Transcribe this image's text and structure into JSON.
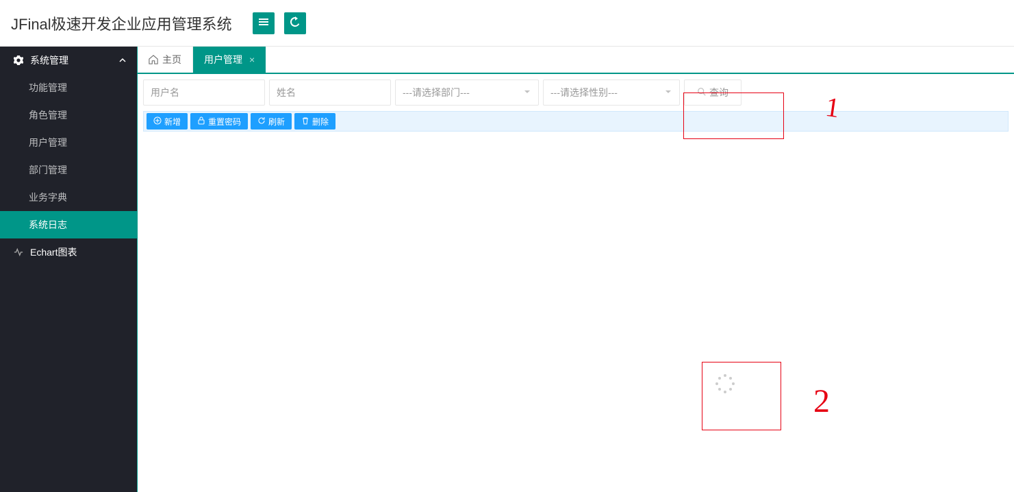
{
  "header": {
    "title": "JFinal极速开发企业应用管理系统"
  },
  "sidebar": {
    "sections": [
      {
        "label": "系统管理",
        "expanded": true
      },
      {
        "label": "功能管理"
      },
      {
        "label": "角色管理"
      },
      {
        "label": "用户管理"
      },
      {
        "label": "部门管理"
      },
      {
        "label": "业务字典"
      },
      {
        "label": "系统日志",
        "active": true
      },
      {
        "label": "Echart图表",
        "top": true
      }
    ]
  },
  "tabs": {
    "home": "主页",
    "user_mgmt": "用户管理"
  },
  "filter": {
    "username_placeholder": "用户名",
    "name_placeholder": "姓名",
    "dept_placeholder": "---请选择部门---",
    "gender_placeholder": "---请选择性别---",
    "query_label": "查询"
  },
  "toolbar": {
    "add": "新增",
    "reset_pwd": "重置密码",
    "refresh": "刷新",
    "delete": "删除"
  },
  "annotations": {
    "label1": "1",
    "label2": "2"
  }
}
